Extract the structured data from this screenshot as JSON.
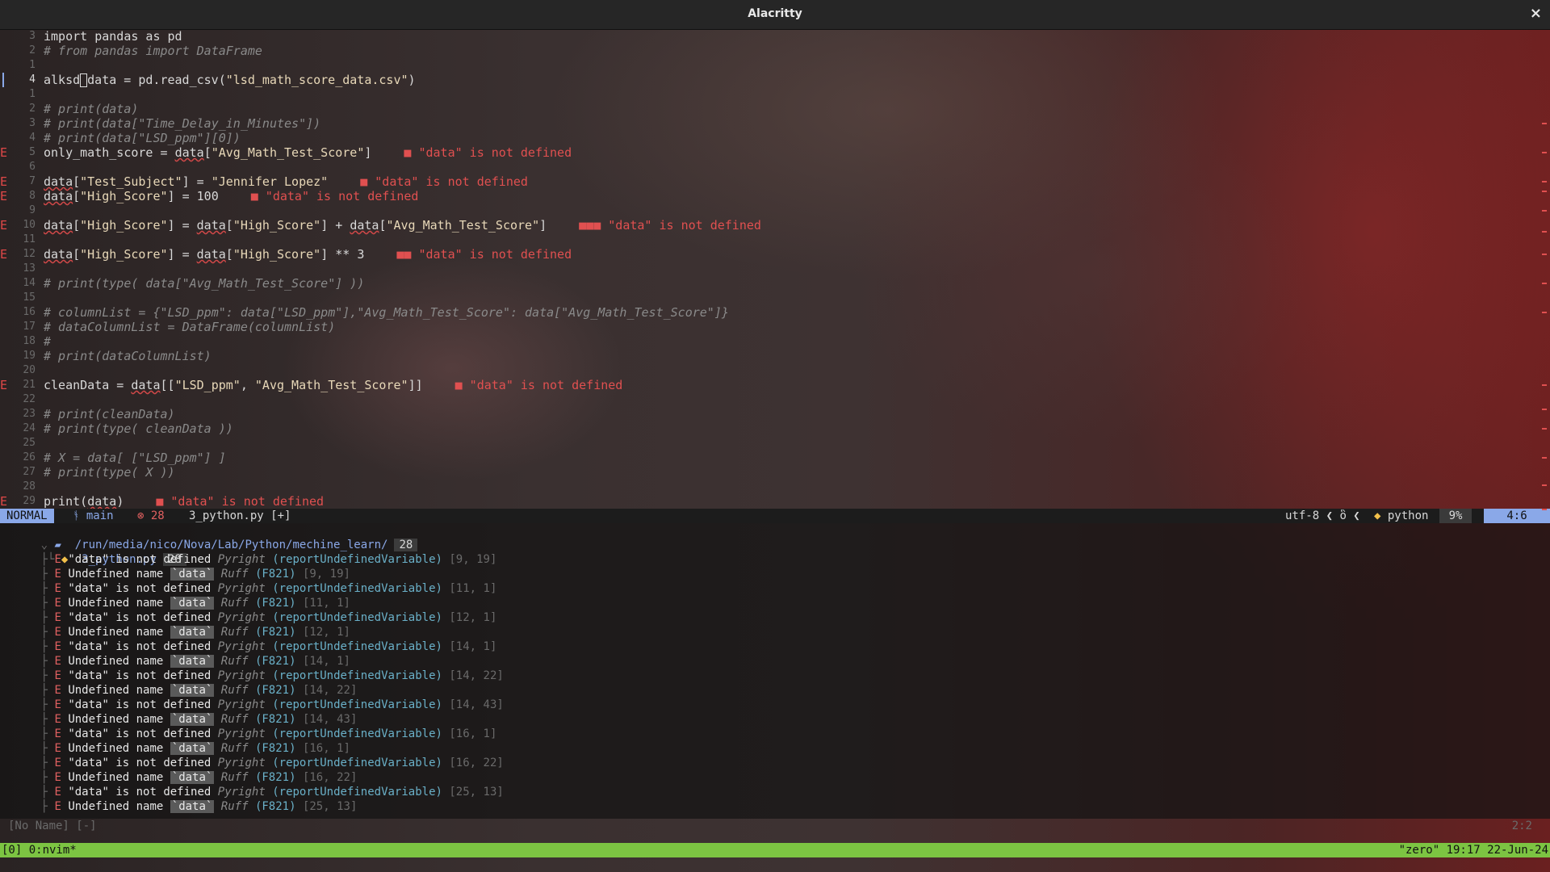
{
  "window": {
    "title": "Alacritty",
    "close": "×"
  },
  "editor_lines": [
    {
      "sign": "",
      "num": "3",
      "code": "import pandas as pd",
      "type": "code"
    },
    {
      "sign": "",
      "num": "2",
      "code": "# from pandas import DataFrame",
      "type": "comment"
    },
    {
      "sign": "",
      "num": "1",
      "code": "",
      "type": "blank"
    },
    {
      "sign": "",
      "num": "4",
      "code": "alksd",
      "code2": "data = pd.read_csv(\"lsd_math_score_data.csv\")",
      "type": "cursor"
    },
    {
      "sign": "",
      "num": "1",
      "code": "",
      "type": "blank"
    },
    {
      "sign": "",
      "num": "2",
      "code": "# print(data)",
      "type": "comment"
    },
    {
      "sign": "",
      "num": "3",
      "code": "# print(data[\"Time_Delay_in_Minutes\"])",
      "type": "comment"
    },
    {
      "sign": "",
      "num": "4",
      "code": "# print(data[\"LSD_ppm\"][0])",
      "type": "comment"
    },
    {
      "sign": "E",
      "num": "5",
      "code": "only_math_score = data[\"Avg_Math_Test_Score\"]",
      "diag": "■ \"data\" is not defined",
      "type": "error"
    },
    {
      "sign": "",
      "num": "6",
      "code": "",
      "type": "blank"
    },
    {
      "sign": "E",
      "num": "7",
      "code": "data[\"Test_Subject\"] = \"Jennifer Lopez\"",
      "diag": "■ \"data\" is not defined",
      "type": "error"
    },
    {
      "sign": "E",
      "num": "8",
      "code": "data[\"High_Score\"] = 100",
      "diag": "■ \"data\" is not defined",
      "type": "error"
    },
    {
      "sign": "",
      "num": "9",
      "code": "",
      "type": "blank"
    },
    {
      "sign": "E",
      "num": "10",
      "code": "data[\"High_Score\"] = data[\"High_Score\"] + data[\"Avg_Math_Test_Score\"]",
      "diag": "■■■ \"data\" is not defined",
      "type": "error"
    },
    {
      "sign": "",
      "num": "11",
      "code": "",
      "type": "blank"
    },
    {
      "sign": "E",
      "num": "12",
      "code": "data[\"High_Score\"] = data[\"High_Score\"] ** 3",
      "diag": "■■ \"data\" is not defined",
      "type": "error"
    },
    {
      "sign": "",
      "num": "13",
      "code": "",
      "type": "blank"
    },
    {
      "sign": "",
      "num": "14",
      "code": "# print(type( data[\"Avg_Math_Test_Score\"] ))",
      "type": "comment"
    },
    {
      "sign": "",
      "num": "15",
      "code": "",
      "type": "blank"
    },
    {
      "sign": "",
      "num": "16",
      "code": "# columnList = {\"LSD_ppm\": data[\"LSD_ppm\"],\"Avg_Math_Test_Score\": data[\"Avg_Math_Test_Score\"]}",
      "type": "comment"
    },
    {
      "sign": "",
      "num": "17",
      "code": "# dataColumnList = DataFrame(columnList)",
      "type": "comment"
    },
    {
      "sign": "",
      "num": "18",
      "code": "#",
      "type": "comment"
    },
    {
      "sign": "",
      "num": "19",
      "code": "# print(dataColumnList)",
      "type": "comment"
    },
    {
      "sign": "",
      "num": "20",
      "code": "",
      "type": "blank"
    },
    {
      "sign": "E",
      "num": "21",
      "code": "cleanData = data[[\"LSD_ppm\", \"Avg_Math_Test_Score\"]]",
      "diag": "■ \"data\" is not defined",
      "type": "error"
    },
    {
      "sign": "",
      "num": "22",
      "code": "",
      "type": "blank"
    },
    {
      "sign": "",
      "num": "23",
      "code": "# print(cleanData)",
      "type": "comment"
    },
    {
      "sign": "",
      "num": "24",
      "code": "# print(type( cleanData ))",
      "type": "comment"
    },
    {
      "sign": "",
      "num": "25",
      "code": "",
      "type": "blank"
    },
    {
      "sign": "",
      "num": "26",
      "code": "# X = data[ [\"LSD_ppm\"] ]",
      "type": "comment"
    },
    {
      "sign": "",
      "num": "27",
      "code": "# print(type( X ))",
      "type": "comment"
    },
    {
      "sign": "",
      "num": "28",
      "code": "",
      "type": "blank"
    },
    {
      "sign": "E",
      "num": "29",
      "code": "print(data)",
      "diag": "■ \"data\" is not defined",
      "type": "error"
    }
  ],
  "statusline": {
    "mode": "NORMAL",
    "branch_icon": "ᚬ",
    "branch": "main",
    "error_count": "⊗ 28",
    "file": "3_python.py [+]",
    "encoding": "utf-8",
    "encoding_extra": "❮ ὃ ❮",
    "lang_icon": "◆",
    "lang": "python",
    "percent": "9%",
    "position": "4:6"
  },
  "trouble": {
    "path": "/run/media/nico/Nova/Lab/Python/mechine_learn/",
    "path_count": "28",
    "file": "3_python.py",
    "file_count": "28",
    "items": [
      {
        "kind": "pyright",
        "msg": "\"data\" is not defined",
        "src": "Pyright",
        "code": "(reportUndefinedVariable)",
        "loc": "[9, 19]"
      },
      {
        "kind": "ruff",
        "msg": "Undefined name",
        "ident": "`data`",
        "src": "Ruff",
        "code": "(F821)",
        "loc": "[9, 19]"
      },
      {
        "kind": "pyright",
        "msg": "\"data\" is not defined",
        "src": "Pyright",
        "code": "(reportUndefinedVariable)",
        "loc": "[11, 1]"
      },
      {
        "kind": "ruff",
        "msg": "Undefined name",
        "ident": "`data`",
        "src": "Ruff",
        "code": "(F821)",
        "loc": "[11, 1]"
      },
      {
        "kind": "pyright",
        "msg": "\"data\" is not defined",
        "src": "Pyright",
        "code": "(reportUndefinedVariable)",
        "loc": "[12, 1]"
      },
      {
        "kind": "ruff",
        "msg": "Undefined name",
        "ident": "`data`",
        "src": "Ruff",
        "code": "(F821)",
        "loc": "[12, 1]"
      },
      {
        "kind": "pyright",
        "msg": "\"data\" is not defined",
        "src": "Pyright",
        "code": "(reportUndefinedVariable)",
        "loc": "[14, 1]"
      },
      {
        "kind": "ruff",
        "msg": "Undefined name",
        "ident": "`data`",
        "src": "Ruff",
        "code": "(F821)",
        "loc": "[14, 1]"
      },
      {
        "kind": "pyright",
        "msg": "\"data\" is not defined",
        "src": "Pyright",
        "code": "(reportUndefinedVariable)",
        "loc": "[14, 22]"
      },
      {
        "kind": "ruff",
        "msg": "Undefined name",
        "ident": "`data`",
        "src": "Ruff",
        "code": "(F821)",
        "loc": "[14, 22]"
      },
      {
        "kind": "pyright",
        "msg": "\"data\" is not defined",
        "src": "Pyright",
        "code": "(reportUndefinedVariable)",
        "loc": "[14, 43]"
      },
      {
        "kind": "ruff",
        "msg": "Undefined name",
        "ident": "`data`",
        "src": "Ruff",
        "code": "(F821)",
        "loc": "[14, 43]"
      },
      {
        "kind": "pyright",
        "msg": "\"data\" is not defined",
        "src": "Pyright",
        "code": "(reportUndefinedVariable)",
        "loc": "[16, 1]"
      },
      {
        "kind": "ruff",
        "msg": "Undefined name",
        "ident": "`data`",
        "src": "Ruff",
        "code": "(F821)",
        "loc": "[16, 1]"
      },
      {
        "kind": "pyright",
        "msg": "\"data\" is not defined",
        "src": "Pyright",
        "code": "(reportUndefinedVariable)",
        "loc": "[16, 22]"
      },
      {
        "kind": "ruff",
        "msg": "Undefined name",
        "ident": "`data`",
        "src": "Ruff",
        "code": "(F821)",
        "loc": "[16, 22]"
      },
      {
        "kind": "pyright",
        "msg": "\"data\" is not defined",
        "src": "Pyright",
        "code": "(reportUndefinedVariable)",
        "loc": "[25, 13]"
      },
      {
        "kind": "ruff",
        "msg": "Undefined name",
        "ident": "`data`",
        "src": "Ruff",
        "code": "(F821)",
        "loc": "[25, 13]"
      }
    ]
  },
  "bottom_buffer": {
    "name": "[No Name]  [-]",
    "pos": "2:2"
  },
  "tmux": {
    "left": "[0] 0:nvim*",
    "right": "\"zero\" 19:17 22-Jun-24"
  },
  "colors": {
    "accent": "#8aa8e8",
    "error": "#e06060",
    "tmux_bar": "#7cc442",
    "lang_icon": "#f2c04a"
  }
}
